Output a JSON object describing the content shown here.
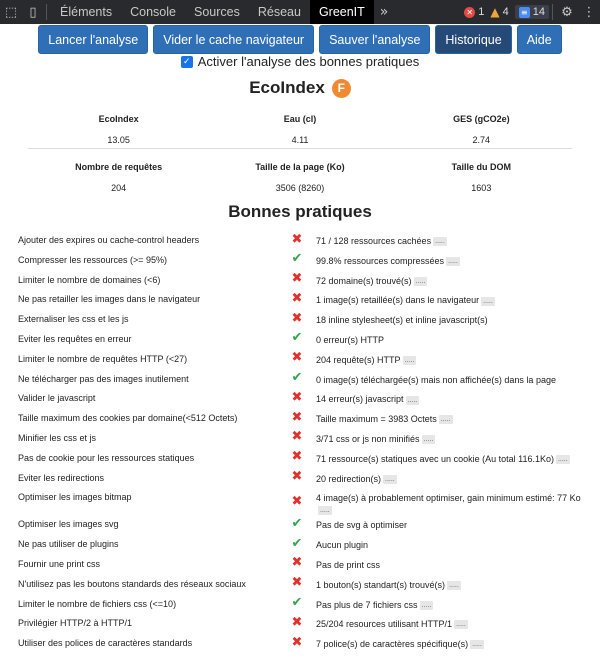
{
  "devtools": {
    "tabs": [
      "Éléments",
      "Console",
      "Sources",
      "Réseau",
      "GreenIT"
    ],
    "active_tab": "GreenIT",
    "errors": "1",
    "warnings": "4",
    "messages": "14"
  },
  "toolbar": {
    "launch": "Lancer l'analyse",
    "clear_cache": "Vider le cache navigateur",
    "save": "Sauver l'analyse",
    "history": "Historique",
    "help": "Aide"
  },
  "best_practices_toggle": {
    "label": "Activer l'analyse des bonnes pratiques",
    "checked": true
  },
  "ecoindex": {
    "title": "EcoIndex",
    "grade": "F",
    "grade_color": "#ef8a32",
    "stats_row1": [
      {
        "label": "EcoIndex",
        "value": "13.05"
      },
      {
        "label": "Eau (cl)",
        "value": "4.11"
      },
      {
        "label": "GES (gCO2e)",
        "value": "2.74"
      }
    ],
    "stats_row2": [
      {
        "label": "Nombre de requêtes",
        "value": "204"
      },
      {
        "label": "Taille de la page (Ko)",
        "value": "3506 (8260)"
      },
      {
        "label": "Taille du DOM",
        "value": "1603"
      }
    ]
  },
  "best_practices": {
    "title": "Bonnes pratiques",
    "more_marker": ".....",
    "status_icons": {
      "bad": "cross-icon",
      "good": "check-icon"
    },
    "rules": [
      {
        "name": "Ajouter des expires ou cache-control headers",
        "status": "bad",
        "comment": "71 / 128 ressources cachées",
        "more": true
      },
      {
        "name": "Compresser les ressources (>= 95%)",
        "status": "good",
        "comment": "99.8% ressources compressées",
        "more": true
      },
      {
        "name": "Limiter le nombre de domaines (<6)",
        "status": "bad",
        "comment": "72 domaine(s) trouvé(s)",
        "more": true
      },
      {
        "name": "Ne pas retailler les images dans le navigateur",
        "status": "bad",
        "comment": "1 image(s) retaillée(s) dans le navigateur",
        "more": true
      },
      {
        "name": "Externaliser les css et les js",
        "status": "bad",
        "comment": "18 inline stylesheet(s) et inline javascript(s)",
        "more": false
      },
      {
        "name": "Eviter les requêtes en erreur",
        "status": "good",
        "comment": "0 erreur(s) HTTP",
        "more": false
      },
      {
        "name": "Limiter le nombre de requêtes HTTP (<27)",
        "status": "bad",
        "comment": "204 requête(s) HTTP",
        "more": true
      },
      {
        "name": "Ne télécharger pas des images inutilement",
        "status": "good",
        "comment": "0 image(s) téléchargée(s) mais non affichée(s) dans la page",
        "more": false
      },
      {
        "name": "Valider le javascript",
        "status": "bad",
        "comment": "14 erreur(s) javascript",
        "more": true
      },
      {
        "name": "Taille maximum des cookies par domaine(<512 Octets)",
        "status": "bad",
        "comment": "Taille maximum = 3983 Octets",
        "more": true
      },
      {
        "name": "Minifier les css et js",
        "status": "bad",
        "comment": "3/71 css or js non minifiés",
        "more": true
      },
      {
        "name": "Pas de cookie pour les ressources statiques",
        "status": "bad",
        "comment": "71 ressource(s) statiques avec un cookie (Au total 116.1Ko)",
        "more": true
      },
      {
        "name": "Eviter les redirections",
        "status": "bad",
        "comment": "20 redirection(s)",
        "more": true
      },
      {
        "name": "Optimiser les images bitmap",
        "status": "bad",
        "comment": "4 image(s) à probablement optimiser, gain minimum estimé: 77 Ko",
        "more": true,
        "tall": true
      },
      {
        "name": "Optimiser les images svg",
        "status": "good",
        "comment": "Pas de svg à optimiser",
        "more": false
      },
      {
        "name": "Ne pas utiliser de plugins",
        "status": "good",
        "comment": "Aucun plugin",
        "more": false
      },
      {
        "name": "Fournir une print css",
        "status": "bad",
        "comment": "Pas de print css",
        "more": false
      },
      {
        "name": "N'utilisez pas les boutons standards des réseaux sociaux",
        "status": "bad",
        "comment": "1 bouton(s) standart(s) trouvé(s)",
        "more": true
      },
      {
        "name": "Limiter le nombre de fichiers css (<=10)",
        "status": "good",
        "comment": "Pas plus de 7 fichiers css",
        "more": true
      },
      {
        "name": "Privilégier HTTP/2 à HTTP/1",
        "status": "bad",
        "comment": "25/204 resources utilisant HTTP/1",
        "more": true
      },
      {
        "name": "Utiliser des polices de caractères standards",
        "status": "bad",
        "comment": "7 police(s) de caractères spécifique(s)",
        "more": true
      }
    ]
  }
}
